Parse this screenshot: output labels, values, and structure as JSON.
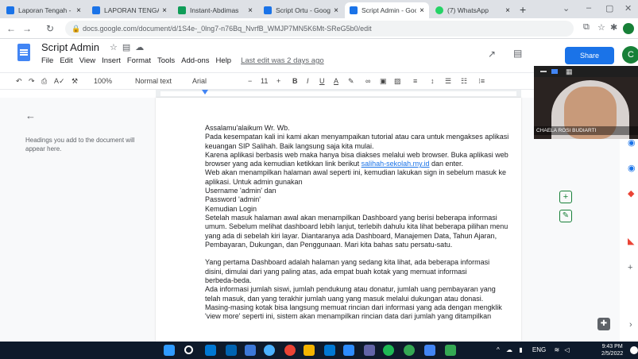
{
  "tabs": [
    {
      "title": "Laporan Tengah - ...",
      "color": "#1a73e8",
      "active": false
    },
    {
      "title": "LAPORAN TENGAH",
      "color": "#1a73e8",
      "active": false
    },
    {
      "title": "Instant-Abdimas",
      "color": "#0f9d58",
      "active": false
    },
    {
      "title": "Script Ortu - Googl",
      "color": "#1a73e8",
      "active": false
    },
    {
      "title": "Script Admin - Goo",
      "color": "#1a73e8",
      "active": true
    },
    {
      "title": "(7) WhatsApp",
      "color": "#25d366",
      "active": false
    }
  ],
  "address": {
    "url": "docs.google.com/document/d/1S4e-_0lng7-n76Bq_NvrfB_WMJP7MN5K6Mt-SReG5b0/edit"
  },
  "doc": {
    "title": "Script Admin",
    "menus": [
      "File",
      "Edit",
      "View",
      "Insert",
      "Format",
      "Tools",
      "Add-ons",
      "Help"
    ],
    "last_edit": "Last edit was 2 days ago",
    "share_label": "Share",
    "avatar_letter": "C"
  },
  "toolbar": {
    "zoom": "100%",
    "style": "Normal text",
    "font": "Arial",
    "font_size": "11"
  },
  "outline": {
    "hint": "Headings you add to the document will appear here."
  },
  "body_lines": [
    "Assalamu'alaikum Wr. Wb.",
    "Pada kesempatan kali ini kami akan menyampaikan tutorial atau cara untuk mengakses aplikasi",
    "keuangan SIP Salihah. Baik langsung saja kita mulai.",
    "Karena aplikasi berbasis web maka hanya bisa diakses melalui web browser. Buka aplikasi web",
    "browser yang ada kemudian ketikkan link berikut ",
    "Web akan menampilkan halaman awal seperti ini, kemudian lakukan sign in sebelum masuk ke",
    "aplikasi. Untuk admin gunakan",
    "Username 'admin' dan",
    "Password 'admin'",
    "Kemudian Login",
    "Setelah masuk halaman awal akan menampilkan Dashboard yang berisi beberapa informasi",
    "umum. Sebelum melihat dashboard lebih lanjut, terlebih dahulu kita lihat beberapa pilihan menu",
    "yang ada di sebelah kiri layar. Diantaranya ada Dashboard, Manajemen Data, Tahun Ajaran,",
    "Pembayaran, Dukungan, dan Penggunaan. Mari kita bahas satu persatu-satu.",
    "",
    "Yang pertama Dashboard adalah halaman yang sedang kita lihat, ada beberapa informasi",
    "disini, dimulai dari yang paling atas, ada empat buah kotak yang memuat informasi",
    "berbeda-beda.",
    "Ada informasi jumlah siswi, jumlah pendukung atau donatur, jumlah uang pembayaran yang",
    "telah masuk, dan yang terakhir jumlah uang yang masuk melalui dukungan atau donasi.",
    "Masing-masing kotak bisa langsung memuat rincian dari informasi yang ada dengan mengklik",
    "'view more' seperti ini, sistem akan menampilkan rincian data dari jumlah yang ditampilkan"
  ],
  "link_text": "salihah-sekolah.my.id",
  "link_suffix": " dan enter.",
  "webcam": {
    "name": "CHAELA ROSI BUDIARTI"
  },
  "taskbar": {
    "lang": "ENG",
    "time": "9:43 PM",
    "date": "2/5/2022"
  }
}
